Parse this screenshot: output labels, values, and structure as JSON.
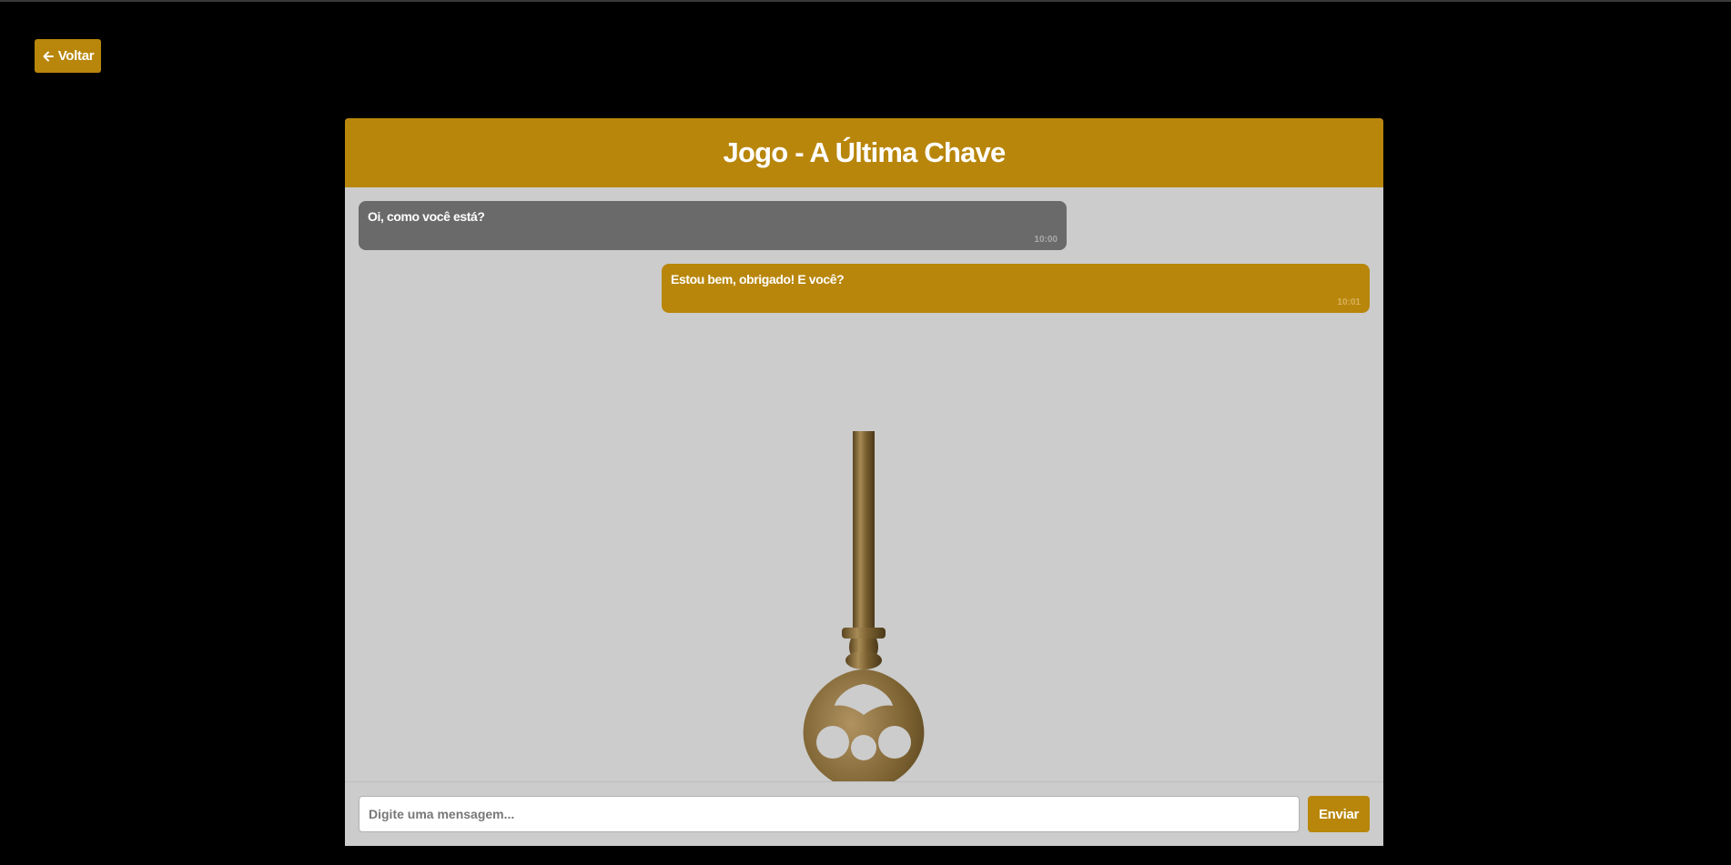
{
  "nav": {
    "back_label": "Voltar",
    "back_icon": "arrow-left-icon"
  },
  "chat": {
    "title": "Jogo - A Última Chave",
    "messages": [
      {
        "direction": "received",
        "text": "Oi, como você está?",
        "time": "10:00"
      },
      {
        "direction": "sent",
        "text": "Estou bem, obrigado! E você?",
        "time": "10:01"
      }
    ],
    "input": {
      "value": "",
      "placeholder": "Digite uma mensagem..."
    },
    "send_label": "Enviar"
  },
  "colors": {
    "accent": "#b8860b",
    "received_bubble": "#6a6a6a",
    "chat_background": "#cccccc",
    "page_background": "#000000"
  }
}
